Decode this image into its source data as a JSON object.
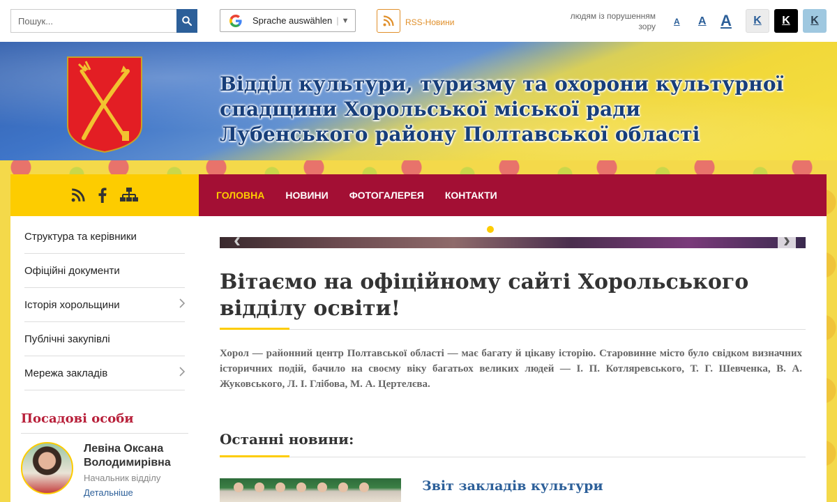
{
  "search": {
    "placeholder": "Пошук..."
  },
  "translate": {
    "label": "Sprache auswählen"
  },
  "rss": {
    "label": "RSS-Новини"
  },
  "accessibility": {
    "label": "людям із порушенням зору",
    "font_small": "A",
    "font_medium": "A",
    "font_large": "A",
    "contrast_default": "K",
    "contrast_black": "K",
    "contrast_blue": "K"
  },
  "header": {
    "title": "Відділ культури, туризму та охорони культурної спадщини Хорольської міської ради Лубенського району Полтавської області"
  },
  "sidebar": {
    "icons": [
      "rss-icon",
      "facebook-icon",
      "sitemap-icon"
    ],
    "items": [
      {
        "label": "Структура та керівники",
        "has_children": false
      },
      {
        "label": "Офіційні документи",
        "has_children": false
      },
      {
        "label": "Історія хорольщини",
        "has_children": true
      },
      {
        "label": "Публічні закупівлі",
        "has_children": false
      },
      {
        "label": "Мережа закладів",
        "has_children": true
      }
    ],
    "officials_title": "Посадові особи",
    "official": {
      "name": "Левіна Оксана Володимирівна",
      "role": "Начальник відділу",
      "more": "Детальніше"
    }
  },
  "nav": {
    "items": [
      {
        "label": "Головна",
        "active": true
      },
      {
        "label": "Новини",
        "active": false
      },
      {
        "label": "Фотогалерея",
        "active": false
      },
      {
        "label": "Контакти",
        "active": false
      }
    ]
  },
  "main": {
    "welcome_title": "Вітаємо на офіційному сайті Хорольського відділу освіти!",
    "intro": "Хорол — районний центр Полтавської області — має багату й цікаву історію. Старовинне місто було свідком визначних історичних подій, бачило на своєму віку багатьох великих людей — І. П. Котляревського, Т. Г. Шевченка, В. А. Жуковського, Л. І. Глібова, М. А. Цертелєва.",
    "news_title": "Останні новини:",
    "news": [
      {
        "title": "Звіт закладів культури"
      }
    ]
  },
  "colors": {
    "primary_blue": "#2c5f99",
    "nav_bg": "#a30f34",
    "accent_yellow": "#fdcc00",
    "rss_orange": "#e08f2a",
    "officials_red": "#b8203a"
  }
}
